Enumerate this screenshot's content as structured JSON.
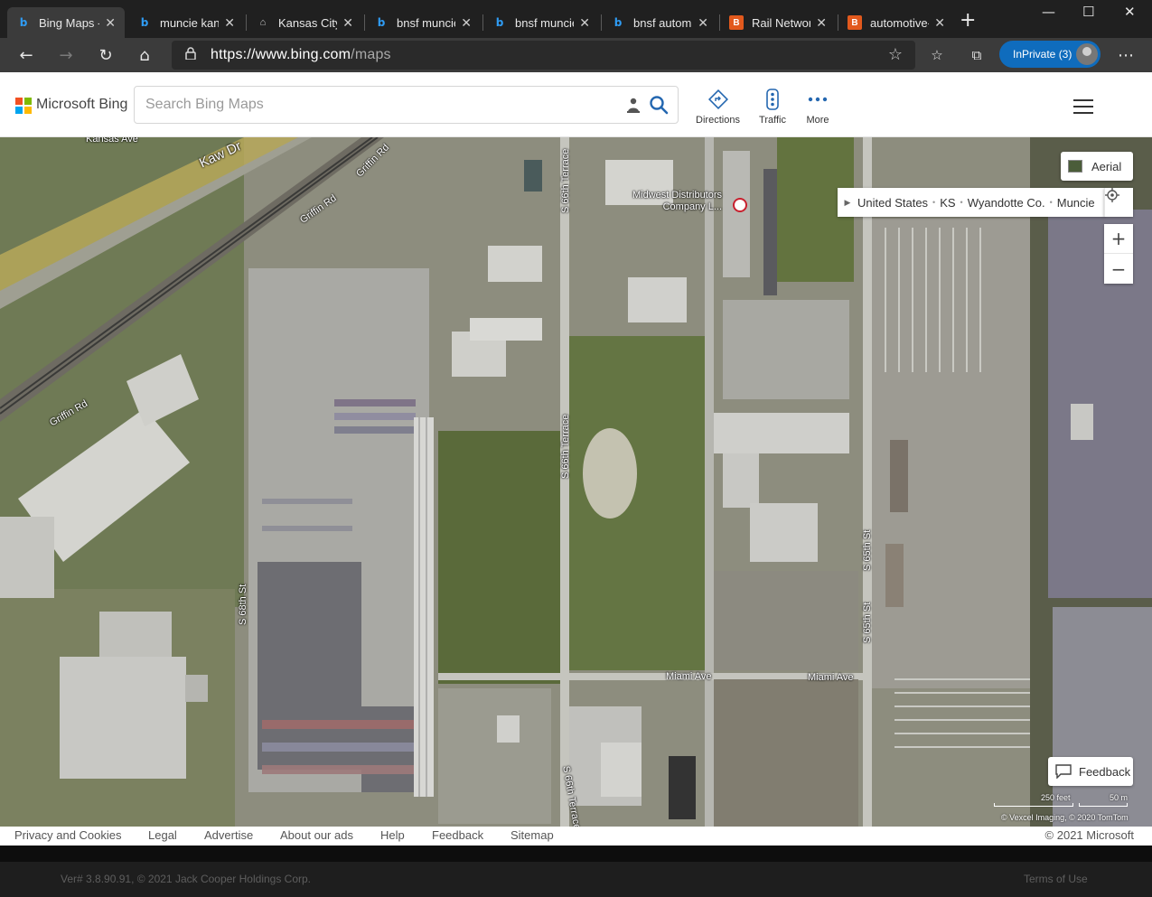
{
  "browser": {
    "tabs": [
      {
        "title": "Bing Maps -",
        "icon": "bing-icon",
        "active": true
      },
      {
        "title": "muncie kans",
        "icon": "bing-icon",
        "active": false
      },
      {
        "title": "Kansas City",
        "icon": "kansas-city-icon",
        "active": false
      },
      {
        "title": "bnsf muncie",
        "icon": "bing-icon",
        "active": false
      },
      {
        "title": "bnsf muncie",
        "icon": "bing-icon",
        "active": false
      },
      {
        "title": "bnsf automa",
        "icon": "bing-icon",
        "active": false
      },
      {
        "title": "Rail Networ",
        "icon": "rail-icon",
        "active": false
      },
      {
        "title": "automotive-",
        "icon": "rail-icon",
        "active": false
      }
    ],
    "url_host": "https://www.bing.com",
    "url_path": "/maps",
    "inprivate_label": "InPrivate (3)"
  },
  "bing": {
    "brand": "Microsoft Bing",
    "search_placeholder": "Search Bing Maps",
    "directions_label": "Directions",
    "traffic_label": "Traffic",
    "more_label": "More",
    "logo_colors": [
      "#f25022",
      "#7fba00",
      "#00a4ef",
      "#ffb900"
    ]
  },
  "map": {
    "labels": {
      "kansas_ave": "Kansas Ave",
      "kaw_dr": "Kaw Dr",
      "griffin_rd_1": "Griffin Rd",
      "griffin_rd_2": "Griffin Rd",
      "griffin_rd_3": "Griffin Rd",
      "s66_terrace_1": "S 66th Terrace",
      "s66_terrace_2": "S 66th Terrace",
      "s66_terrace_3": "S 66th Terrace",
      "s68_st": "S 68th St",
      "s65_st_1": "S 65th St",
      "s65_st_2": "S 65th St",
      "miami_ave_1": "Miami Ave",
      "miami_ave_2": "Miami Ave"
    },
    "poi_line1": "Midwest Distributors",
    "poi_line2": "Company L...",
    "aerial_label": "Aerial",
    "breadcrumb": [
      "United States",
      "KS",
      "Wyandotte Co.",
      "Muncie"
    ],
    "feedback_label": "Feedback",
    "scale_feet": "250 feet",
    "scale_m": "50 m",
    "imagery_credit": "© Vexcel Imaging, © 2020 TomTom"
  },
  "footer": {
    "links": [
      "Privacy and Cookies",
      "Legal",
      "Advertise",
      "About our ads",
      "Help",
      "Feedback",
      "Sitemap"
    ],
    "copyright": "© 2021 Microsoft"
  },
  "bottom": {
    "version": "Ver# 3.8.90.91, © 2021 Jack Cooper Holdings Corp.",
    "terms": "Terms of Use"
  }
}
